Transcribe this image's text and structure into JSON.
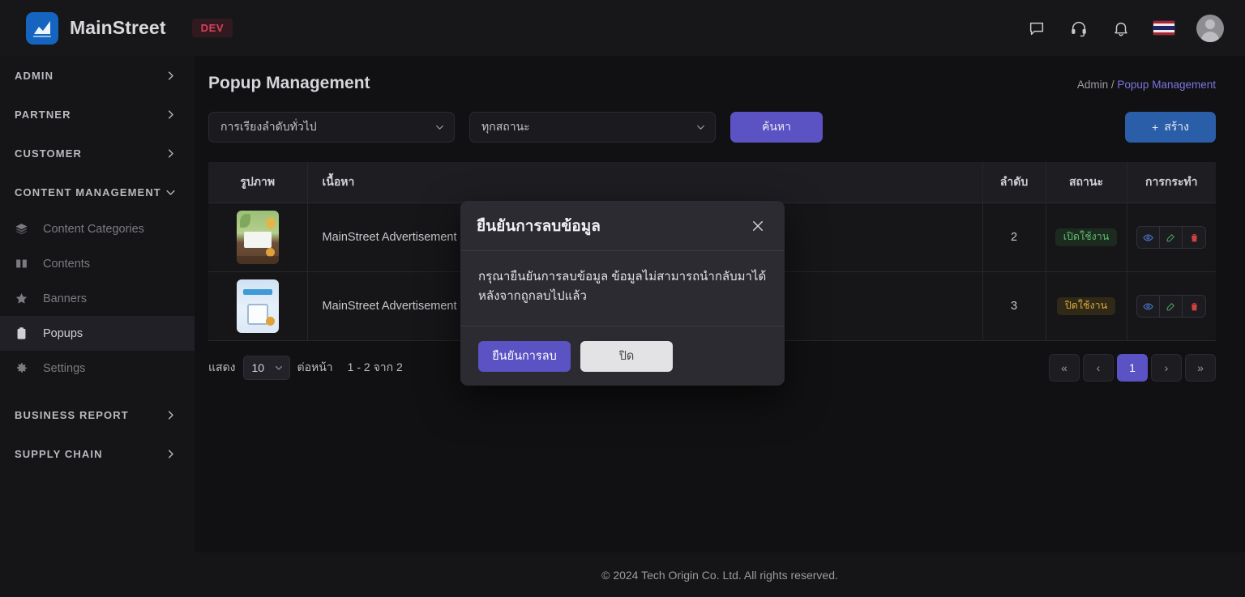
{
  "topbar": {
    "brand_name": "MainStreet",
    "env_badge": "DEV",
    "icons": [
      "chat-icon",
      "support-headset-icon",
      "bell-icon",
      "thai-flag-icon",
      "avatar"
    ]
  },
  "sidebar": {
    "sections": [
      {
        "label": "ADMIN",
        "expanded": false
      },
      {
        "label": "PARTNER",
        "expanded": false
      },
      {
        "label": "CUSTOMER",
        "expanded": false
      },
      {
        "label": "CONTENT MANAGEMENT",
        "expanded": true
      }
    ],
    "sub_items": [
      {
        "label": "Content Categories",
        "icon": "layers-icon",
        "active": false
      },
      {
        "label": "Contents",
        "icon": "book-icon",
        "active": false
      },
      {
        "label": "Banners",
        "icon": "star-icon",
        "active": false
      },
      {
        "label": "Popups",
        "icon": "clipboard-icon",
        "active": true
      },
      {
        "label": "Settings",
        "icon": "gear-icon",
        "active": false
      }
    ],
    "sections_bottom": [
      {
        "label": "BUSINESS REPORT",
        "expanded": false
      },
      {
        "label": "SUPPLY CHAIN",
        "expanded": false
      }
    ]
  },
  "page": {
    "title": "Popup Management",
    "breadcrumb_parent": "Admin",
    "breadcrumb_sep": "/",
    "breadcrumb_current": "Popup Management"
  },
  "filters": {
    "sort_value": "การเรียงลำดับทั่วไป",
    "status_value": "ทุกสถานะ",
    "search_label": "ค้นหา",
    "create_label": "สร้าง",
    "create_plus": "+"
  },
  "table": {
    "headers": [
      "รูปภาพ",
      "เนื้อหา",
      "ลำดับ",
      "สถานะ",
      "การกระทำ"
    ],
    "rows": [
      {
        "thumb": "garden-advertisement-thumbnail",
        "content": "MainStreet Advertisement Banner",
        "order": "2",
        "status": "เปิดใช้งาน",
        "status_state": "on",
        "actions": [
          "eye-icon",
          "edit-icon",
          "trash-icon"
        ]
      },
      {
        "thumb": "tablet-advertisement-thumbnail",
        "content": "MainStreet Advertisement Banner",
        "order": "3",
        "status": "ปิดใช้งาน",
        "status_state": "off",
        "actions": [
          "eye-icon",
          "edit-icon",
          "trash-icon"
        ]
      }
    ]
  },
  "pagination": {
    "show_label": "แสดง",
    "per_page_value": "10",
    "per_page_label": "ต่อหน้า",
    "range_text": "1 - 2 จาก 2",
    "first": "«",
    "prev": "‹",
    "current_page": "1",
    "next": "›",
    "last": "»"
  },
  "footer": {
    "copyright": "© 2024 Tech Origin Co. Ltd. All rights reserved."
  },
  "modal": {
    "title": "ยืนยันการลบข้อมูล",
    "body": "กรุณายืนยันการลบข้อมูล ข้อมูลไม่สามารถนำกลับมาได้หลังจากถูกลบไปแล้ว",
    "confirm_label": "ยืนยันการลบ",
    "close_label": "ปิด"
  },
  "colors": {
    "accent_purple": "#5b52c4",
    "accent_blue": "#2b5ea8",
    "status_on": "#62bb6e",
    "status_off": "#d8ab3b",
    "danger": "#cf4141",
    "link": "#7d74e0"
  }
}
